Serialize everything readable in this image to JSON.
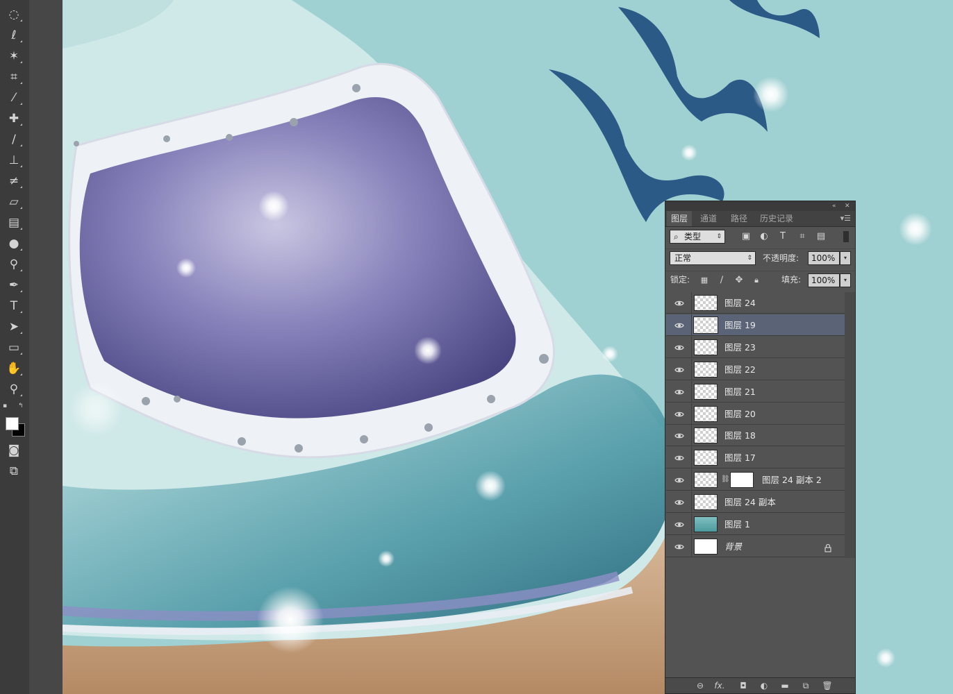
{
  "toolbar": {
    "tools": [
      {
        "name": "marquee-tool-icon",
        "glyph": "◌"
      },
      {
        "name": "lasso-tool-icon",
        "glyph": "ℓ"
      },
      {
        "name": "magic-wand-tool-icon",
        "glyph": "✶"
      },
      {
        "name": "crop-tool-icon",
        "glyph": "⌗"
      },
      {
        "name": "eyedropper-tool-icon",
        "glyph": "⁄"
      },
      {
        "name": "healing-brush-tool-icon",
        "glyph": "✚"
      },
      {
        "name": "brush-tool-icon",
        "glyph": "∕"
      },
      {
        "name": "clone-stamp-tool-icon",
        "glyph": "⊥"
      },
      {
        "name": "history-brush-tool-icon",
        "glyph": "≠"
      },
      {
        "name": "eraser-tool-icon",
        "glyph": "▱"
      },
      {
        "name": "gradient-tool-icon",
        "glyph": "▤"
      },
      {
        "name": "blur-tool-icon",
        "glyph": "●"
      },
      {
        "name": "dodge-tool-icon",
        "glyph": "⚲"
      },
      {
        "name": "pen-tool-icon",
        "glyph": "✒"
      },
      {
        "name": "type-tool-icon",
        "glyph": "T"
      },
      {
        "name": "path-selection-tool-icon",
        "glyph": "➤"
      },
      {
        "name": "rectangle-tool-icon",
        "glyph": "▭"
      },
      {
        "name": "hand-tool-icon",
        "glyph": "✋"
      },
      {
        "name": "zoom-tool-icon",
        "glyph": "⚲"
      }
    ],
    "foreground_color": "#ffffff",
    "background_color": "#000000"
  },
  "panel": {
    "tabs": [
      "图层",
      "通道",
      "路径",
      "历史记录"
    ],
    "filter_kind": "类型",
    "blend_mode": "正常",
    "opacity_label": "不透明度:",
    "opacity_value": "100%",
    "lock_label": "锁定:",
    "fill_label": "填充:",
    "fill_value": "100%",
    "layers": [
      {
        "name": "图层 24",
        "thumb": "transparent",
        "selected": false
      },
      {
        "name": "图层 19",
        "thumb": "transparent",
        "selected": true
      },
      {
        "name": "图层 23",
        "thumb": "transparent",
        "selected": false
      },
      {
        "name": "图层 22",
        "thumb": "transparent",
        "selected": false
      },
      {
        "name": "图层 21",
        "thumb": "transparent",
        "selected": false
      },
      {
        "name": "图层 20",
        "thumb": "transparent",
        "selected": false
      },
      {
        "name": "图层 18",
        "thumb": "transparent",
        "selected": false
      },
      {
        "name": "图层 17",
        "thumb": "transparent",
        "selected": false
      },
      {
        "name": "图层 24 副本 2",
        "thumb": "transparent",
        "mask": true,
        "selected": false
      },
      {
        "name": "图层 24 副本",
        "thumb": "transparent",
        "selected": false
      },
      {
        "name": "图层 1",
        "thumb": "teal",
        "selected": false
      },
      {
        "name": "背景",
        "thumb": "white",
        "locked": true,
        "italic": true,
        "selected": false
      }
    ],
    "bottom_icons": [
      "link-layers-icon",
      "fx-icon",
      "add-mask-icon",
      "adjustment-layer-icon",
      "new-group-icon",
      "new-layer-icon",
      "delete-layer-icon"
    ],
    "fx_label": "fx."
  },
  "colors": {
    "accent_selected": "#5b6477",
    "canvas_bg": "#9ccfd1"
  }
}
